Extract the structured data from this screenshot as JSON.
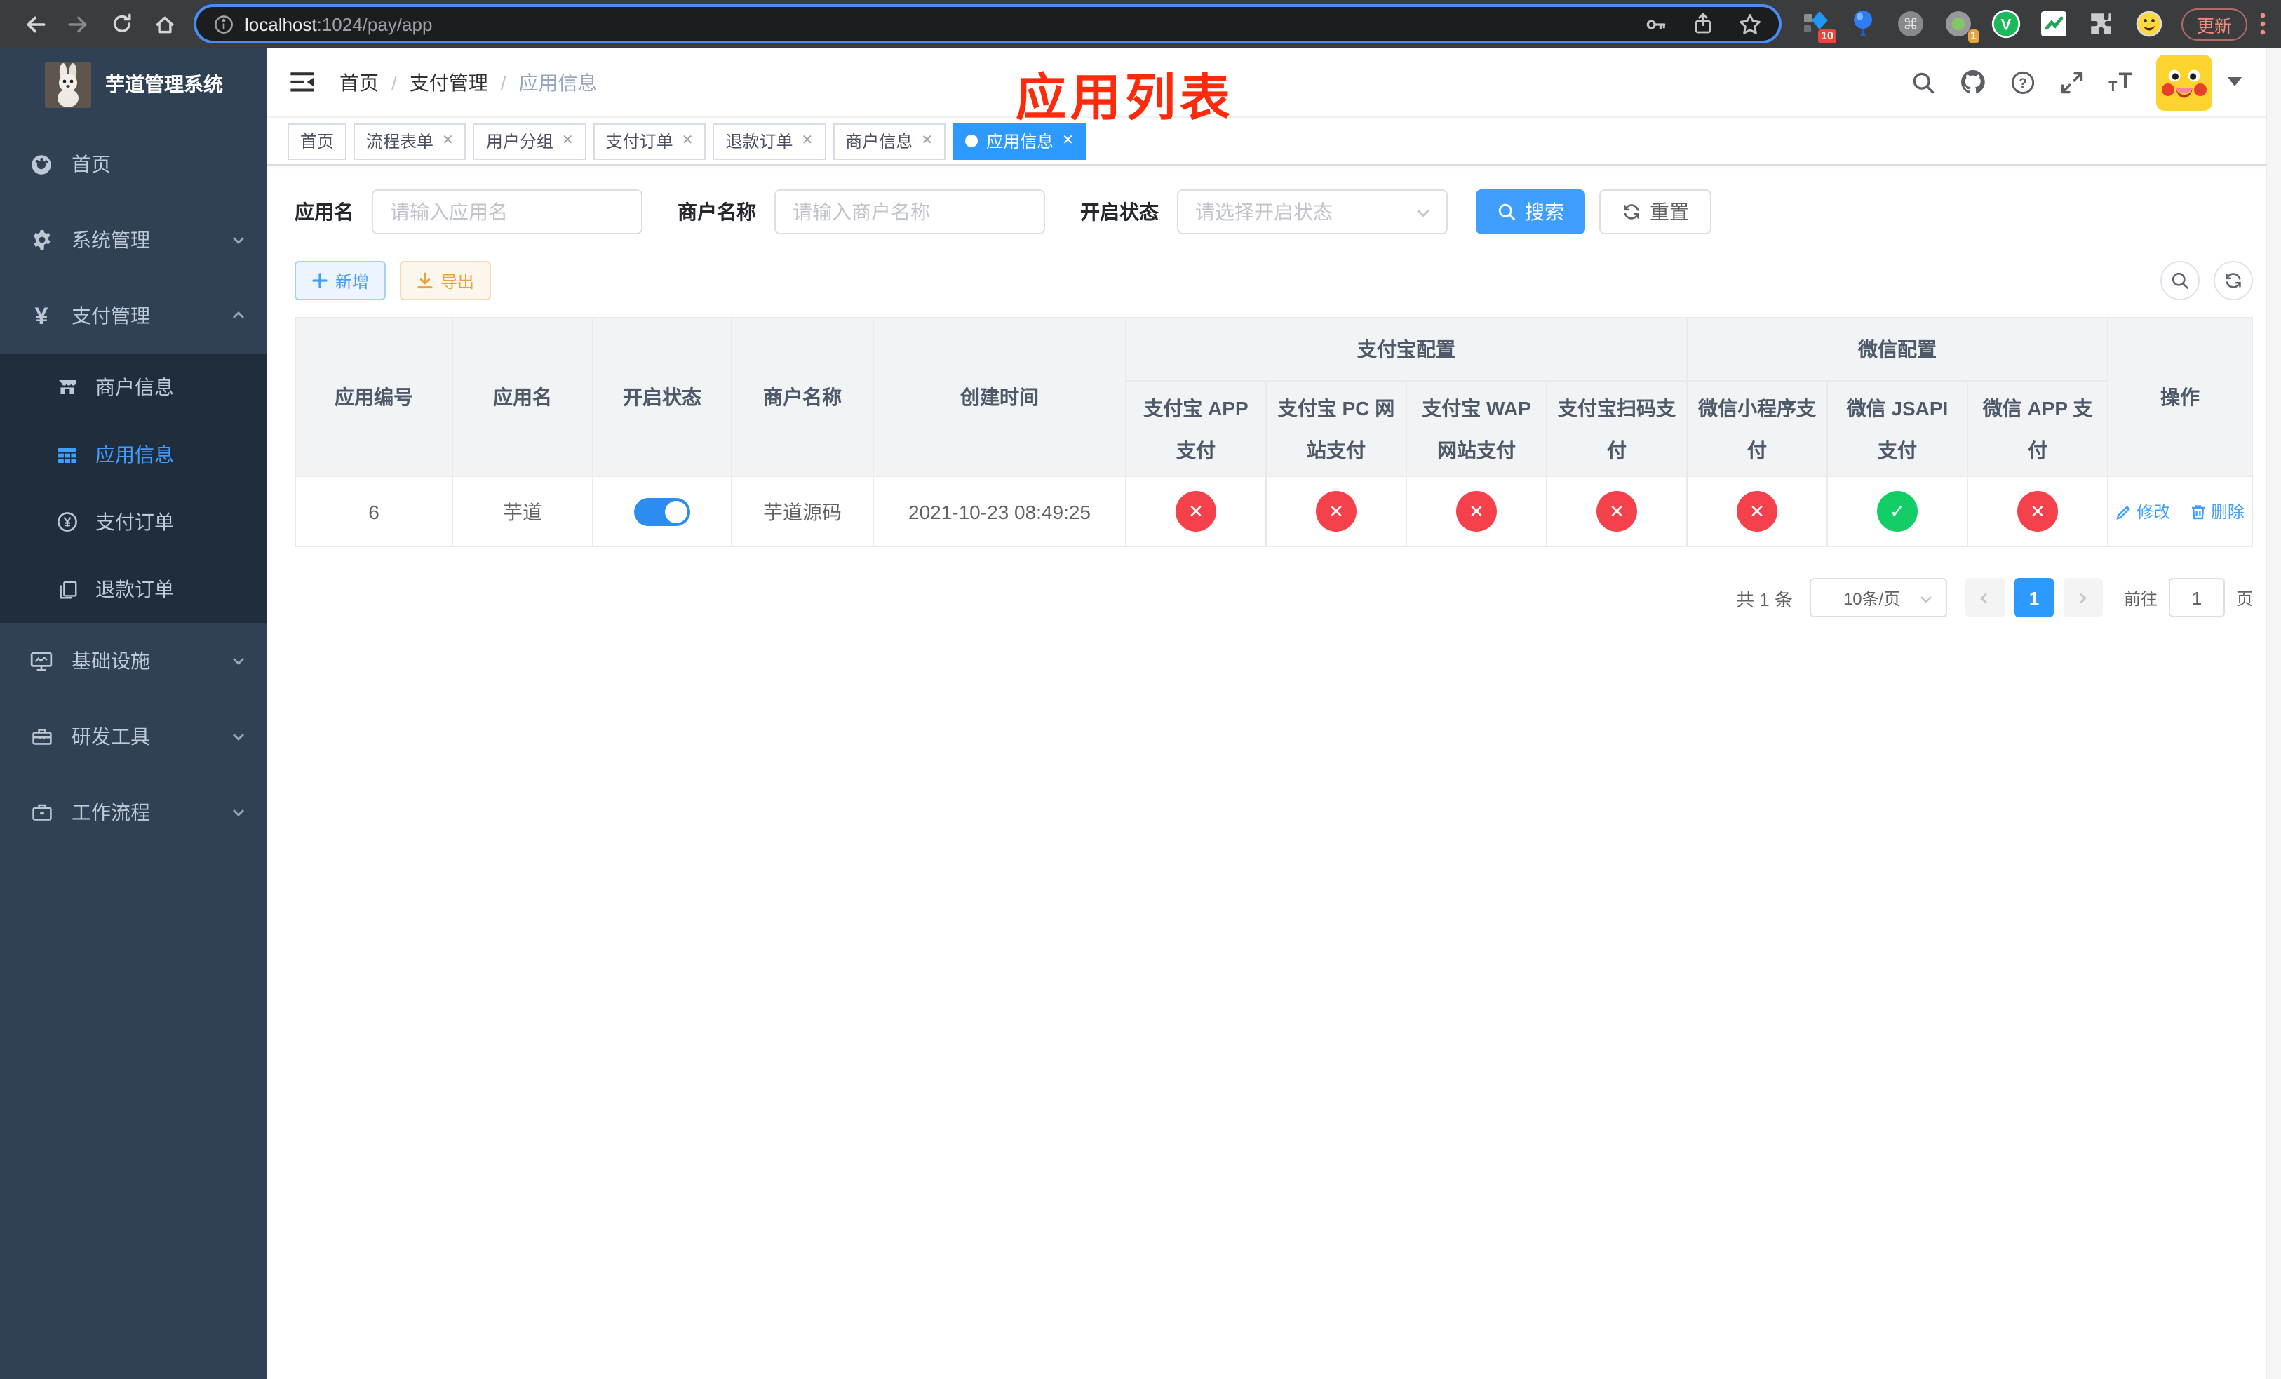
{
  "browser": {
    "url_host": "localhost",
    "url_path": ":1024/pay/app",
    "ext_badge_blue": "10",
    "ext_badge_dot": "1",
    "update_label": "更新"
  },
  "sidebar": {
    "title": "芋道管理系统",
    "menu_top": [
      {
        "label": "首页"
      },
      {
        "label": "系统管理"
      },
      {
        "label": "支付管理"
      }
    ],
    "submenu": [
      {
        "label": "商户信息"
      },
      {
        "label": "应用信息"
      },
      {
        "label": "支付订单"
      },
      {
        "label": "退款订单"
      }
    ],
    "menu_bottom": [
      {
        "label": "基础设施"
      },
      {
        "label": "研发工具"
      },
      {
        "label": "工作流程"
      }
    ]
  },
  "navbar": {
    "breadcrumb": [
      "首页",
      "支付管理",
      "应用信息"
    ],
    "annotation": "应用列表"
  },
  "tags": [
    {
      "label": "首页"
    },
    {
      "label": "流程表单"
    },
    {
      "label": "用户分组"
    },
    {
      "label": "支付订单"
    },
    {
      "label": "退款订单"
    },
    {
      "label": "商户信息"
    },
    {
      "label": "应用信息"
    }
  ],
  "filters": {
    "app_name_label": "应用名",
    "app_name_placeholder": "请输入应用名",
    "merchant_label": "商户名称",
    "merchant_placeholder": "请输入商户名称",
    "status_label": "开启状态",
    "status_placeholder": "请选择开启状态",
    "search_label": "搜索",
    "reset_label": "重置"
  },
  "toolbar": {
    "add_label": "新增",
    "export_label": "导出"
  },
  "table": {
    "columns": [
      "应用编号",
      "应用名",
      "开启状态",
      "商户名称",
      "创建时间"
    ],
    "groups": [
      {
        "label": "支付宝配置",
        "children": [
          "支付宝 APP 支付",
          "支付宝 PC 网站支付",
          "支付宝 WAP 网站支付",
          "支付宝扫码支付"
        ]
      },
      {
        "label": "微信配置",
        "children": [
          "微信小程序支付",
          "微信 JSAPI 支付",
          "微信 APP 支付"
        ]
      }
    ],
    "op_label": "操作",
    "rows": [
      {
        "id": "6",
        "name": "芋道",
        "status": "on",
        "merchant": "芋道源码",
        "created": "2021-10-23 08:49:25",
        "channels": [
          "no",
          "no",
          "no",
          "no",
          "no",
          "yes",
          "no"
        ],
        "edit_label": "修改",
        "delete_label": "删除"
      }
    ]
  },
  "pagination": {
    "total": "共 1 条",
    "page_size": "10条/页",
    "current_page": "1",
    "goto_label": "前往",
    "goto_value": "1",
    "page_label": "页"
  }
}
